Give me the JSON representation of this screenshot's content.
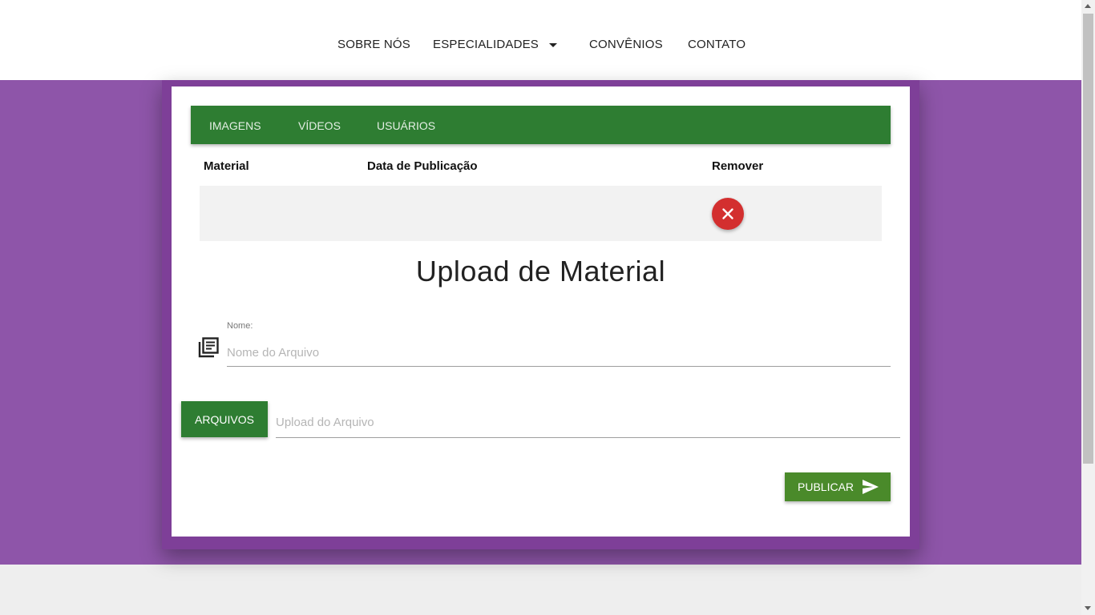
{
  "nav": {
    "about": "SOBRE NÓS",
    "specialties": "ESPECIALIDADES",
    "agreements": "CONVÊNIOS",
    "contact": "CONTATO"
  },
  "tabs": [
    "IMAGENS",
    "VÍDEOS",
    "USUÁRIOS"
  ],
  "table": {
    "headers": [
      "Material",
      "Data de Publicação",
      "Remover"
    ],
    "rows": [
      {
        "material": "",
        "date": ""
      }
    ]
  },
  "upload": {
    "title": "Upload de Material",
    "name_label": "Nome:",
    "name_placeholder": "Nome do Arquivo",
    "files_button": "ARQUIVOS",
    "file_placeholder": "Upload do Arquivo",
    "publish_button": "PUBLICAR"
  },
  "colors": {
    "accent_green": "#2e7d32",
    "publish_green": "#4a8a2a",
    "purple": "#8e55a9",
    "danger": "#d32f2f"
  },
  "icons": {
    "specialties_dropdown": "caret-down-icon",
    "remove": "close-icon",
    "name_field": "library-books-icon",
    "publish": "send-icon"
  }
}
